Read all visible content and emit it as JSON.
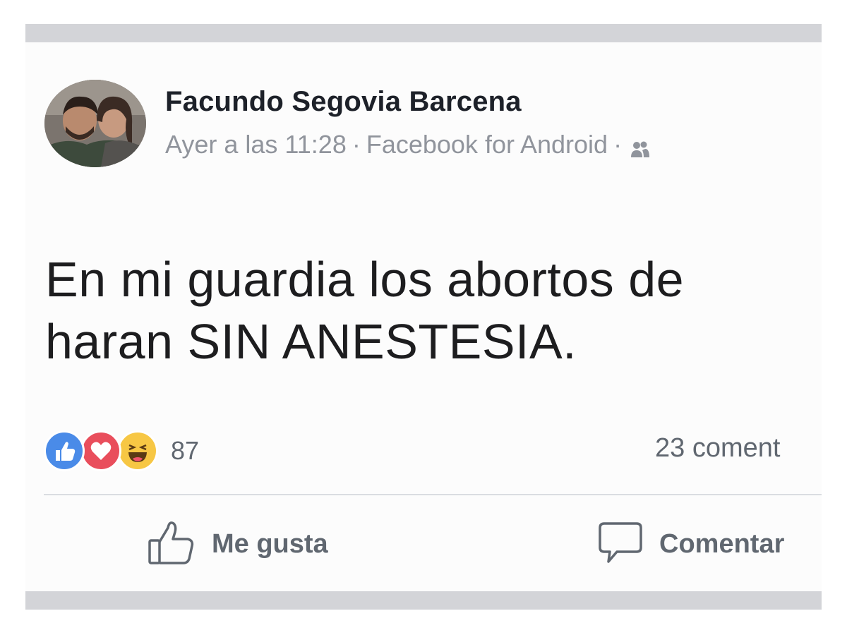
{
  "post": {
    "author_name": "Facundo Segovia Barcena",
    "time": "Ayer a las 11:28",
    "separator": "·",
    "source": "Facebook for Android",
    "audience_icon": "friends-icon",
    "text_line1": "En mi guardia los abortos de",
    "text_line2": "haran SIN ANESTESIA."
  },
  "reactions": {
    "icons": [
      "like-reaction-icon",
      "love-reaction-icon",
      "haha-reaction-icon"
    ],
    "count": "87",
    "comments": "23 coment"
  },
  "actions": {
    "like_label": "Me gusta",
    "comment_label": "Comentar"
  },
  "colors": {
    "like_blue": "#4a8be8",
    "love_red": "#e94e5c",
    "haha_yellow": "#f7c744",
    "meta_gray": "#90949c",
    "frame_gray": "#d3d4d8"
  }
}
